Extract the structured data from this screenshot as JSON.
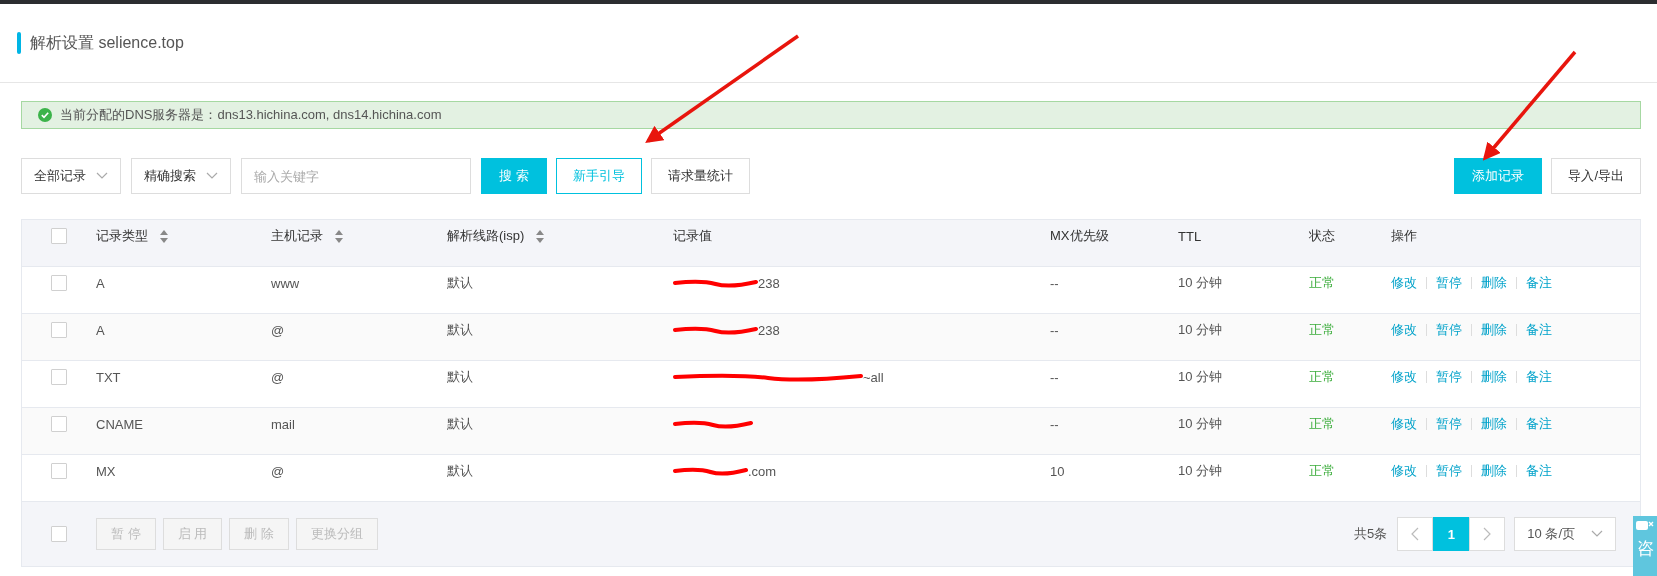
{
  "page_title": "解析设置 selience.top",
  "alert": {
    "text": "当前分配的DNS服务器是：dns13.hichina.com, dns14.hichina.com"
  },
  "toolbar": {
    "filters": [
      {
        "label": "全部记录"
      },
      {
        "label": "精确搜索"
      }
    ],
    "search": {
      "placeholder": "输入关键字"
    },
    "buttons": [
      {
        "label": "搜 索",
        "kind": "primary"
      },
      {
        "label": "新手引导",
        "kind": "outline"
      },
      {
        "label": "请求量统计",
        "kind": "default"
      }
    ],
    "right_buttons": [
      {
        "label": "添加记录",
        "kind": "primary"
      },
      {
        "label": "导入/导出",
        "kind": "default"
      }
    ]
  },
  "table": {
    "select_all_checked": false,
    "columns": [
      {
        "label": "记录类型",
        "sortable": true
      },
      {
        "label": "主机记录",
        "sortable": true
      },
      {
        "label": "解析线路(isp)",
        "sortable": true
      },
      {
        "label": "记录值",
        "sortable": false
      },
      {
        "label": "MX优先级",
        "sortable": false
      },
      {
        "label": "TTL",
        "sortable": false
      },
      {
        "label": "状态",
        "sortable": false
      },
      {
        "label": "操作",
        "sortable": false
      }
    ],
    "rows": [
      {
        "checked": false,
        "type": "A",
        "host": "www",
        "line": "默认",
        "value": "238",
        "value_redacted": true,
        "mx": "--",
        "ttl": "10 分钟",
        "status": "正常",
        "actions": [
          "修改",
          "暂停",
          "删除",
          "备注"
        ]
      },
      {
        "checked": false,
        "type": "A",
        "host": "@",
        "line": "默认",
        "value": "238",
        "value_redacted": true,
        "mx": "--",
        "ttl": "10 分钟",
        "status": "正常",
        "actions": [
          "修改",
          "暂停",
          "删除",
          "备注"
        ]
      },
      {
        "checked": false,
        "type": "TXT",
        "host": "@",
        "line": "默认",
        "value": "~all",
        "value_redacted": true,
        "mx": "--",
        "ttl": "10 分钟",
        "status": "正常",
        "actions": [
          "修改",
          "暂停",
          "删除",
          "备注"
        ]
      },
      {
        "checked": false,
        "type": "CNAME",
        "host": "mail",
        "line": "默认",
        "value_redacted": true,
        "mx": "--",
        "ttl": "10 分钟",
        "status": "正常",
        "actions": [
          "修改",
          "暂停",
          "删除",
          "备注"
        ]
      },
      {
        "checked": false,
        "type": "MX",
        "host": "@",
        "line": "默认",
        "value": ".com",
        "value_redacted": true,
        "mx": "10",
        "ttl": "10 分钟",
        "status": "正常",
        "actions": [
          "修改",
          "暂停",
          "删除",
          "备注"
        ]
      }
    ]
  },
  "footer": {
    "select_all_checked": false,
    "bulk_actions": [
      {
        "label": "暂 停",
        "disabled": true
      },
      {
        "label": "启 用",
        "disabled": true
      },
      {
        "label": "删 除",
        "disabled": true
      },
      {
        "label": "更换分组",
        "disabled": true
      }
    ]
  },
  "pagination": {
    "total": "共5条",
    "pages": [
      {
        "label": "1",
        "selected": true
      }
    ],
    "page_size": "10 条/页"
  },
  "side_tab": {
    "label": "咨"
  }
}
